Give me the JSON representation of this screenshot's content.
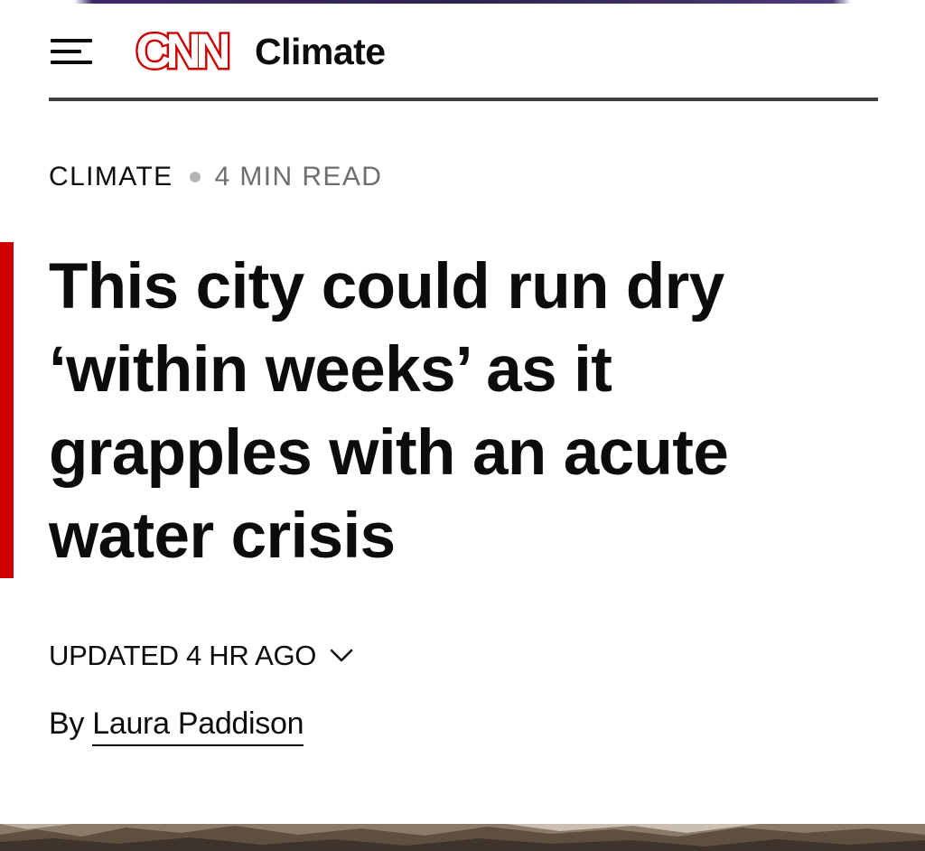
{
  "header": {
    "menu_icon": "hamburger-menu-icon",
    "logo_text": "CNN",
    "section_name": "Climate",
    "brand_color": "#cc0000"
  },
  "kicker": {
    "section": "CLIMATE",
    "read_time": "4 MIN READ"
  },
  "article": {
    "headline": "This city could run dry ‘within weeks’ as it grapples with an acute water crisis",
    "updated": "UPDATED 4 HR AGO",
    "updated_icon": "chevron-down-icon",
    "byline_prefix": "By",
    "author": "Laura Paddison"
  },
  "colors": {
    "accent_red": "#cc0000",
    "text": "#0c0c0c",
    "muted": "#6e6e6e",
    "rule": "#404040"
  }
}
